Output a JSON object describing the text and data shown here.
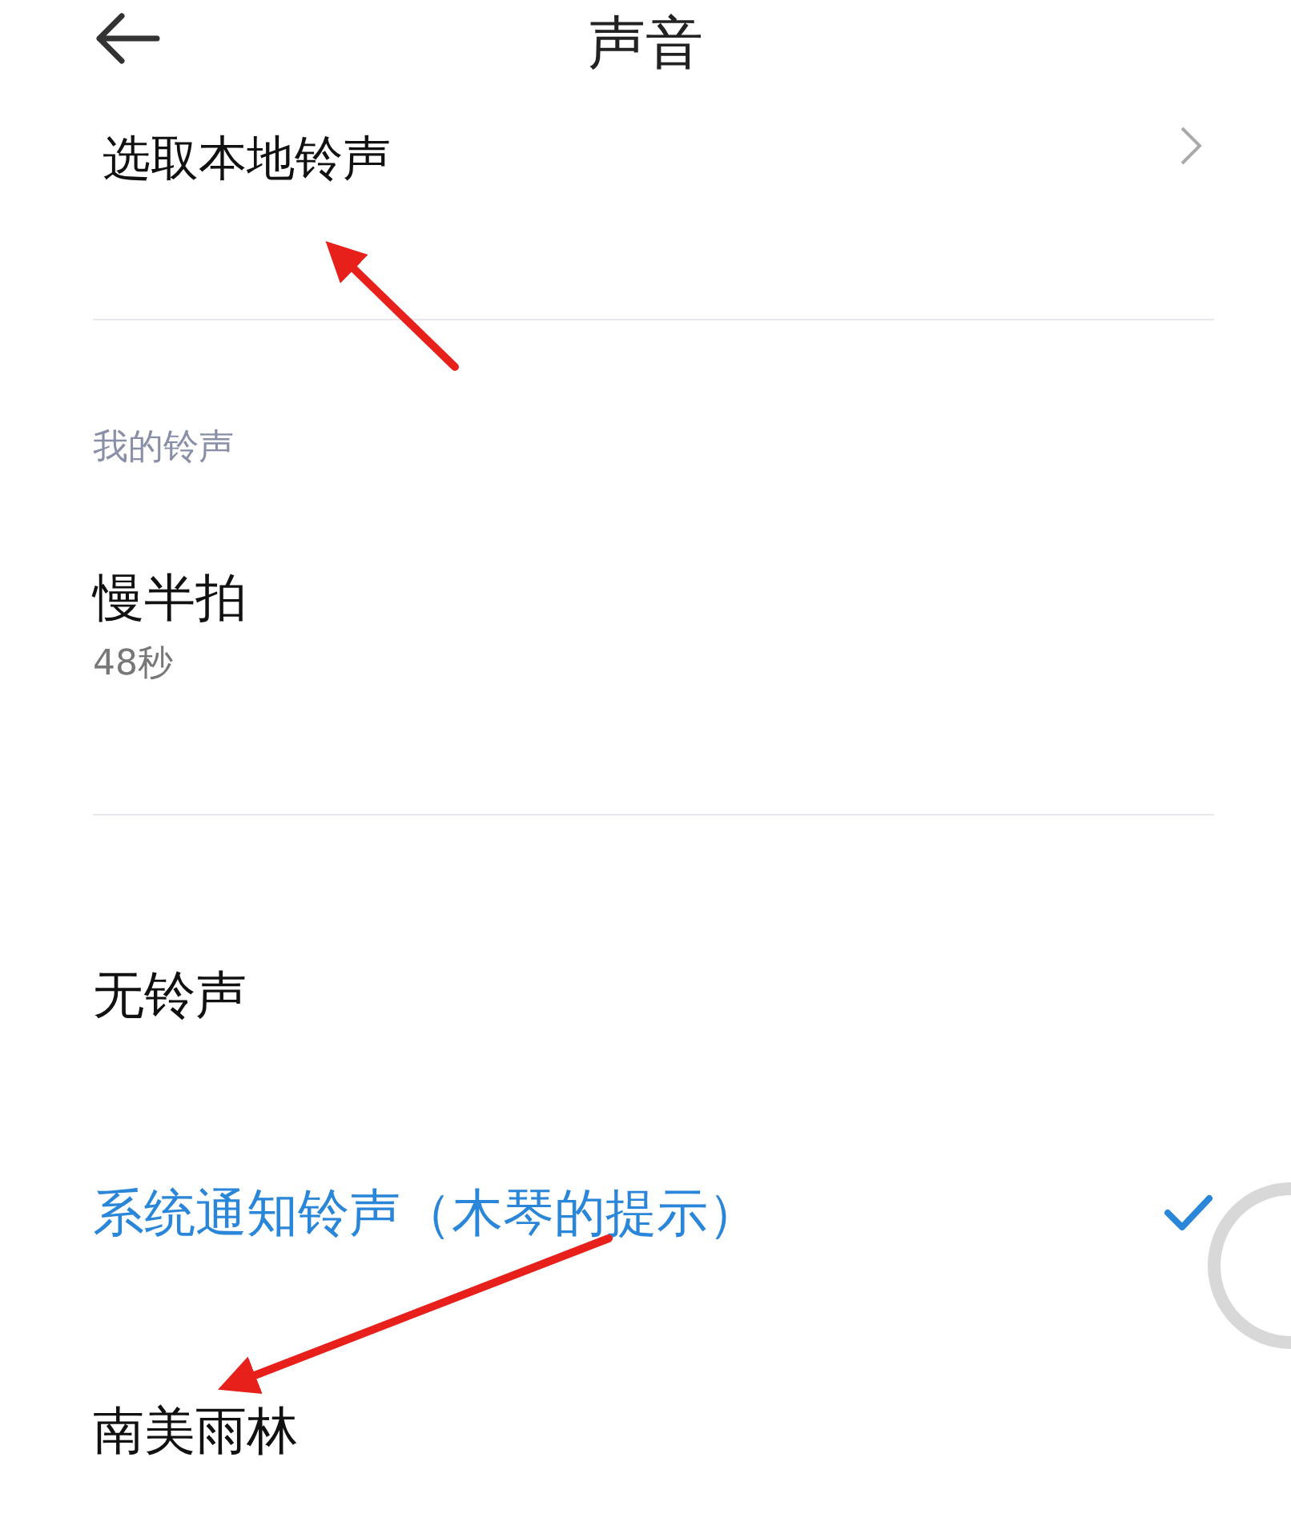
{
  "header": {
    "title": "声音"
  },
  "local_picker": {
    "label": "选取本地铃声"
  },
  "section": {
    "title": "我的铃声"
  },
  "my_ringtones": [
    {
      "name": "慢半拍",
      "duration": "48秒"
    }
  ],
  "ringtones": [
    {
      "name": "无铃声",
      "selected": false
    },
    {
      "name": "系统通知铃声（木琴的提示）",
      "selected": true
    },
    {
      "name": "南美雨林",
      "selected": false
    }
  ]
}
